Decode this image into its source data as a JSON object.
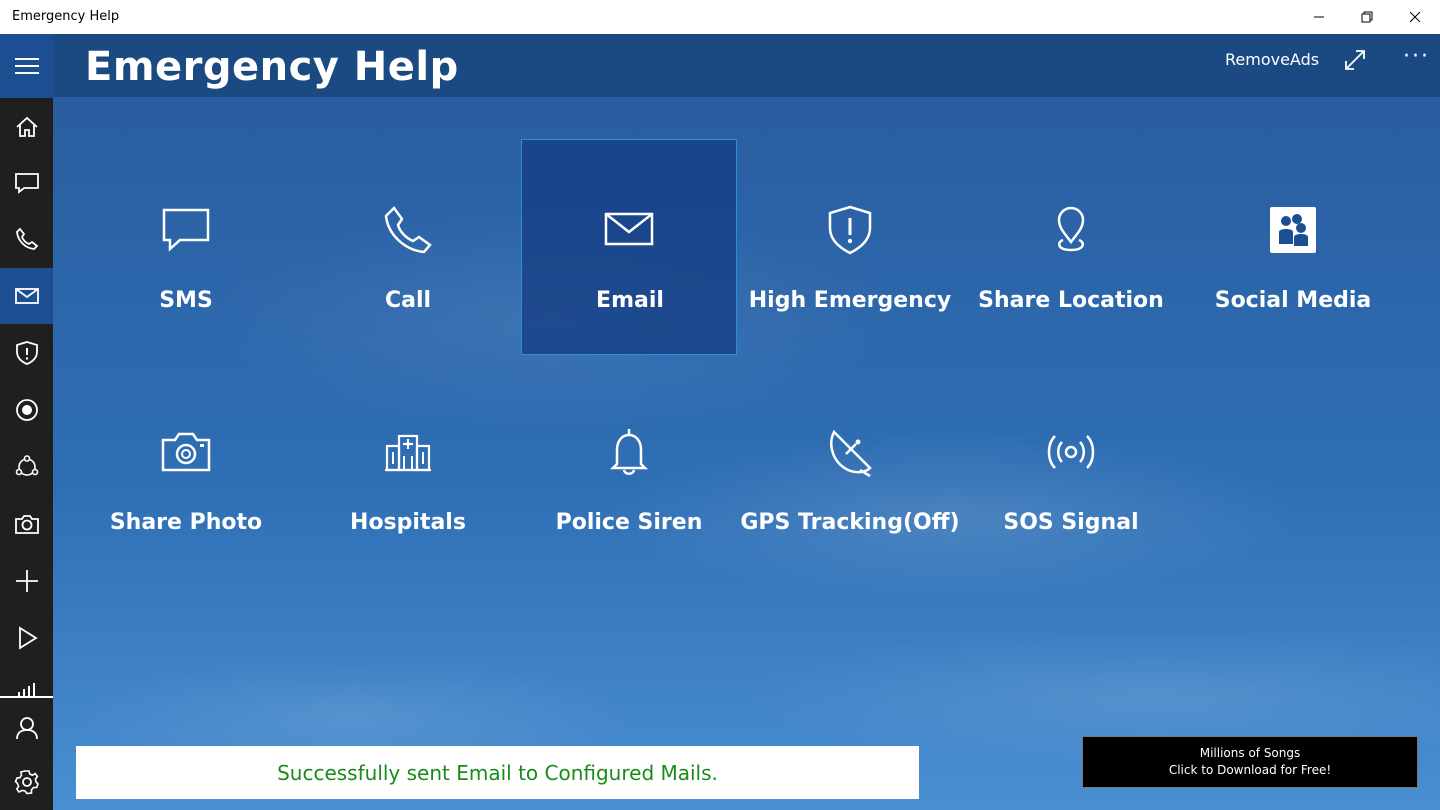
{
  "window": {
    "title": "Emergency Help"
  },
  "header": {
    "title": "Emergency Help",
    "remove_ads": "RemoveAds"
  },
  "sidebar": {
    "items": [
      {
        "icon": "home-icon"
      },
      {
        "icon": "chat-icon"
      },
      {
        "icon": "phone-icon"
      },
      {
        "icon": "mail-icon",
        "active": true
      },
      {
        "icon": "shield-alert-icon"
      },
      {
        "icon": "record-icon"
      },
      {
        "icon": "share-network-icon"
      },
      {
        "icon": "camera-icon"
      },
      {
        "icon": "add-icon"
      },
      {
        "icon": "play-icon"
      },
      {
        "icon": "signal-bars-icon"
      },
      {
        "icon": "user-icon"
      },
      {
        "icon": "settings-icon"
      }
    ]
  },
  "tiles": [
    {
      "label": "SMS",
      "icon": "chat-icon"
    },
    {
      "label": "Call",
      "icon": "phone-icon"
    },
    {
      "label": "Email",
      "icon": "mail-icon",
      "selected": true
    },
    {
      "label": "High Emergency",
      "icon": "shield-alert-icon"
    },
    {
      "label": "Share Location",
      "icon": "location-pin-icon"
    },
    {
      "label": "Social Media",
      "icon": "people-icon"
    },
    {
      "label": "Share Photo",
      "icon": "camera-icon"
    },
    {
      "label": "Hospitals",
      "icon": "hospital-icon"
    },
    {
      "label": "Police Siren",
      "icon": "bell-icon"
    },
    {
      "label": "GPS Tracking(Off)",
      "icon": "satellite-dish-icon"
    },
    {
      "label": "SOS Signal",
      "icon": "broadcast-icon"
    }
  ],
  "status": {
    "message": "Successfully sent Email to Configured Mails."
  },
  "ad": {
    "line1": "Millions of Songs",
    "line2": "Click to Download for Free!"
  },
  "colors": {
    "accent": "#1b4f92",
    "status_text": "#1a8a1a",
    "sidebar_bg": "#1f1f1f"
  }
}
